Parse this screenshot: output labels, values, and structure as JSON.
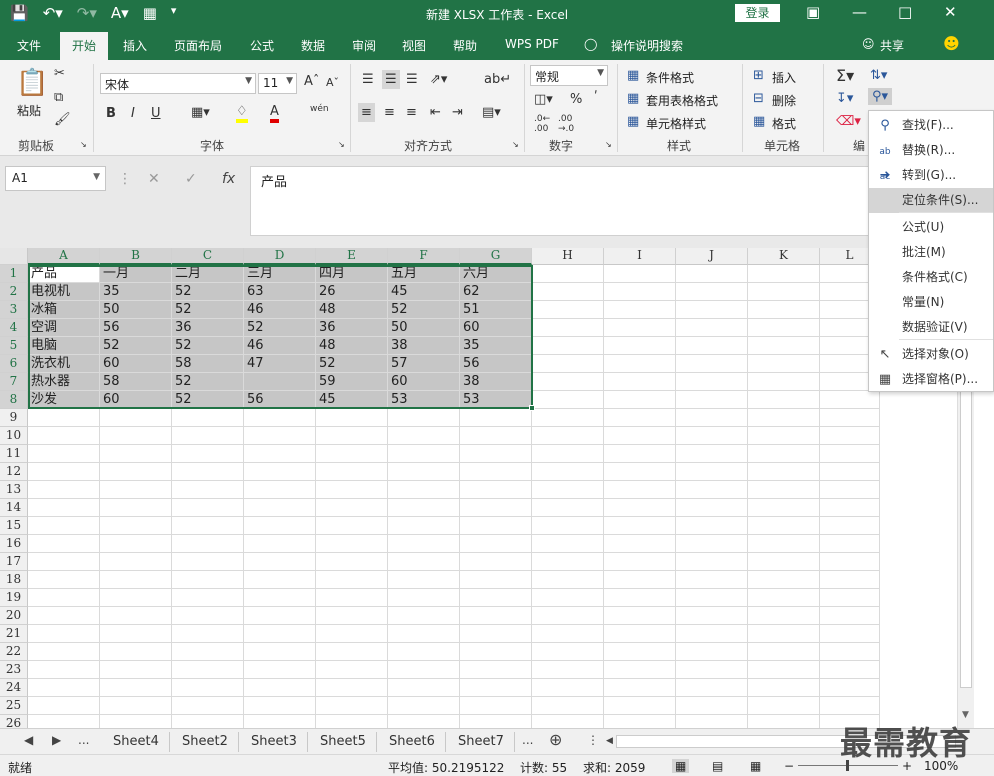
{
  "window": {
    "title": "新建 XLSX 工作表  -  Excel",
    "login": "登录",
    "qat": [
      "save-icon",
      "undo-icon",
      "redo-icon",
      "format-painter-icon",
      "print-preview-icon"
    ]
  },
  "tabs": [
    "文件",
    "开始",
    "插入",
    "页面布局",
    "公式",
    "数据",
    "审阅",
    "视图",
    "帮助",
    "WPS PDF",
    "操作说明搜索",
    "共享"
  ],
  "ribbon": {
    "clipboard": {
      "paste": "粘贴",
      "label": "剪贴板"
    },
    "font": {
      "name": "宋体",
      "size": "11",
      "label": "字体",
      "bold": "B",
      "italic": "I",
      "underline": "U",
      "phonetic": "wén"
    },
    "alignment": {
      "label": "对齐方式"
    },
    "number": {
      "format": "常规",
      "label": "数字"
    },
    "styles": {
      "cond": "条件格式",
      "table": "套用表格格式",
      "cell": "单元格样式",
      "label": "样式"
    },
    "cells": {
      "insert": "插入",
      "delete": "删除",
      "format": "格式",
      "label": "单元格"
    },
    "editing": {
      "label": "编"
    }
  },
  "formula_bar": {
    "name_box": "A1",
    "content": "产品",
    "fx": "fx"
  },
  "columns": [
    "A",
    "B",
    "C",
    "D",
    "E",
    "F",
    "G",
    "H",
    "I",
    "J",
    "K",
    "L"
  ],
  "rows": [
    "1",
    "2",
    "3",
    "4",
    "5",
    "6",
    "7",
    "8",
    "9",
    "10",
    "11",
    "12",
    "13",
    "14",
    "15",
    "16",
    "17",
    "18",
    "19",
    "20",
    "21",
    "22",
    "23",
    "24",
    "25",
    "26"
  ],
  "table": [
    [
      "产品",
      "一月",
      "二月",
      "三月",
      "四月",
      "五月",
      "六月"
    ],
    [
      "电视机",
      "35",
      "52",
      "63",
      "26",
      "45",
      "62"
    ],
    [
      "冰箱",
      "50",
      "52",
      "46",
      "48",
      "52",
      "51"
    ],
    [
      "空调",
      "56",
      "36",
      "52",
      "36",
      "50",
      "60"
    ],
    [
      "电脑",
      "52",
      "52",
      "46",
      "48",
      "38",
      "35"
    ],
    [
      "洗衣机",
      "60",
      "58",
      "47",
      "52",
      "57",
      "56"
    ],
    [
      "热水器",
      "58",
      "52",
      "",
      "59",
      "60",
      "38"
    ],
    [
      "沙发",
      "60",
      "52",
      "56",
      "45",
      "53",
      "53"
    ]
  ],
  "menu": [
    {
      "label": "查找(F)...",
      "icon": "search-icon"
    },
    {
      "label": "替换(R)...",
      "icon": "replace-icon"
    },
    {
      "label": "转到(G)...",
      "icon": "arrow-right-icon"
    },
    {
      "label": "定位条件(S)...",
      "icon": "",
      "highlighted": true
    },
    {
      "label": "公式(U)",
      "icon": ""
    },
    {
      "label": "批注(M)",
      "icon": ""
    },
    {
      "label": "条件格式(C)",
      "icon": ""
    },
    {
      "label": "常量(N)",
      "icon": ""
    },
    {
      "label": "数据验证(V)",
      "icon": ""
    },
    {
      "label": "选择对象(O)",
      "icon": "cursor-icon"
    },
    {
      "label": "选择窗格(P)...",
      "icon": "selection-pane-icon"
    }
  ],
  "sheets": [
    "Sheet4",
    "Sheet2",
    "Sheet3",
    "Sheet5",
    "Sheet6",
    "Sheet7"
  ],
  "status": {
    "ready": "就绪",
    "average": "平均值: 50.2195122",
    "count": "计数: 55",
    "sum": "求和: 2059",
    "zoom": "100%"
  },
  "watermark": "最需教育",
  "colors": {
    "accent": "#217346",
    "selection": "#c6c6c6"
  }
}
